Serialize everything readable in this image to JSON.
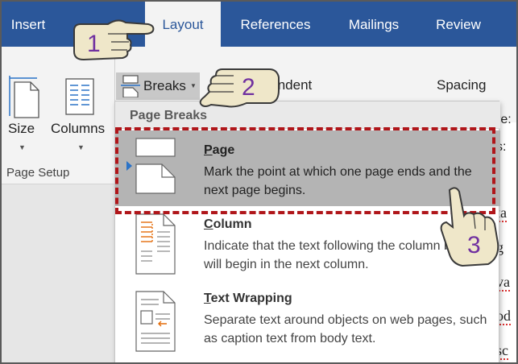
{
  "tabs": [
    {
      "label": "Insert",
      "active": false
    },
    {
      "label": "Layout",
      "active": true
    },
    {
      "label": "References",
      "active": false
    },
    {
      "label": "Mailings",
      "active": false
    },
    {
      "label": "Review",
      "active": false
    }
  ],
  "ribbon": {
    "size_label": "Size",
    "columns_label": "Columns",
    "group_label": "Page Setup",
    "breaks_label": "Breaks",
    "indent_label": "Indent",
    "spacing_label": "Spacing"
  },
  "dropdown": {
    "header": "Page Breaks",
    "items": [
      {
        "title_ul": "P",
        "title_rest": "age",
        "desc": "Mark the point at which one page ends and the next page begins."
      },
      {
        "title_ul": "C",
        "title_rest": "olumn",
        "desc": "Indicate that the text following the column break will begin in the next column."
      },
      {
        "title_ul": "T",
        "title_rest": "ext Wrapping",
        "desc": "Separate text around objects on web pages, such as caption text from body text."
      }
    ]
  },
  "callouts": {
    "step1": "1",
    "step2": "2",
    "step3": "3"
  },
  "doc_fragments": [
    "re:",
    "s:",
    "ta",
    "g",
    "va",
    "od",
    "sc"
  ],
  "colors": {
    "ribbon_blue": "#2b579a",
    "highlight_red": "#b0161a",
    "number_purple": "#7030a0"
  }
}
